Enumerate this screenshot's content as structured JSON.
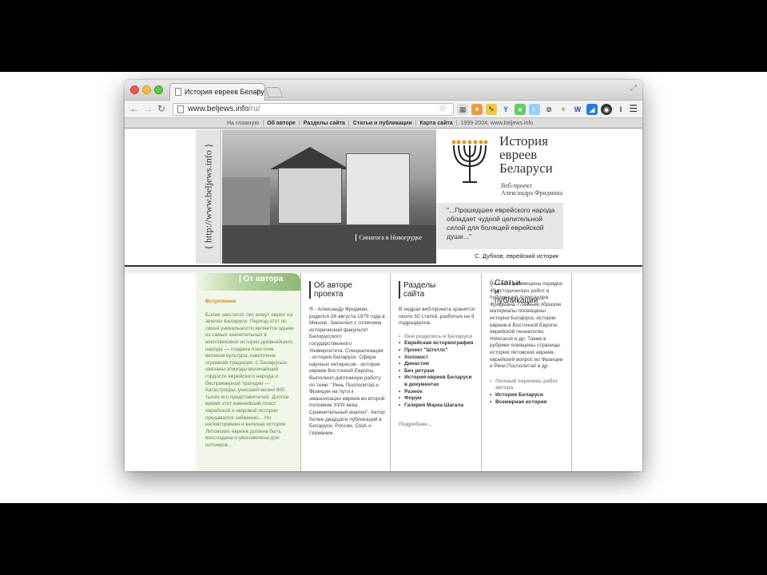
{
  "browser": {
    "tab_title": "История евреев Беларуси",
    "url_host": "www.beljews.info",
    "url_path": "/ru/"
  },
  "site_nav": {
    "items": [
      "На главную",
      "Об авторе",
      "Разделы сайта",
      "Статьи и публикации",
      "Карта сайта"
    ],
    "copyright": "1999-2004, www.beljews.info"
  },
  "banner": {
    "vertical_url": "{ http://www.beljews.info }",
    "photo_caption": "Синагога в Новогрудке",
    "title_lines": [
      "История",
      "евреев",
      "Беларуси"
    ],
    "subtitle_lines": [
      "Веб-проект",
      "Александра Фридмана"
    ],
    "quote": "\"...Прошедшее еврейского народа обладает чудной целительной силой для болящей еврейской души...\"",
    "quote_author": "С. Дубнов, еврейский историк"
  },
  "author_col": {
    "heading": "| От автора",
    "intro": "Вступление",
    "text": "Более шестисот лет живут евреи на землях Беларуси. Период этот по своей уникальности является одним из самых значительных в многовековой истории древнейшего народа — создана поистине великая культура, накоплена огромная традиция. С Беларусью связаны эпизоды величайшей гордости еврейского народа и беспримерной трагедии — Катастрофы, унесшей жизни 800 тысяч его представителей. Долгое время этот важнейший пласт еврейской и мировой истории предавался забвению... Но неповторимая и великая история Литовских евреев должна быть воссоздана и увековечена для потомков..."
  },
  "about_col": {
    "heading_lines": [
      "Об авторе",
      "проекта"
    ],
    "text": "Я - Александр Фридман, родился 26 августа 1979 года в Минске. Закончил с отличием исторический факультет Белорусского государственного Университета. Специализация - история Беларуси. Сфера научных интересов - история евреев Восточной Европы. Выполнил дипломную работу по теме: \"Речь Посполитая и Франция на пути к эмансипации евреев во второй половине XVIII века. Сравнительный анализ\". Автор более двадцати публикаций в Беларуси, России, США и Германии."
  },
  "sections_col": {
    "heading_lines": [
      "Разделы",
      "сайта"
    ],
    "text": "В недрах веб-проекта хранятся около 50 статей, разбитых на 9 подразделов.",
    "items": [
      "Они родились в Беларуси",
      "Еврейская историография",
      "Проект \"Штетлс\"",
      "Холокост",
      "Династии",
      "Без ретуши",
      "История евреев Беларуси в документах",
      "Разное",
      "Форум",
      "Галерея Марка Шагала"
    ],
    "more": "Подробнее..."
  },
  "pubs_col": {
    "heading_lines": [
      "Статьи и",
      "публикации"
    ],
    "text": "На сайте размещены порядка 45 исторических работ и публикаций Александра Фридмана. Главным образом материалы посвящены истории Беларуси, истории евреев в Восточной Европе, еврейской генеалогии, Holocaust и др. Также в рубрике освящены страницы истории литовских евреев, еврейский вопрос во Франции и Речи Посполитой и др.",
    "items": [
      "Полный перечень работ автора",
      "История Беларуси",
      "Всемирная история"
    ]
  }
}
